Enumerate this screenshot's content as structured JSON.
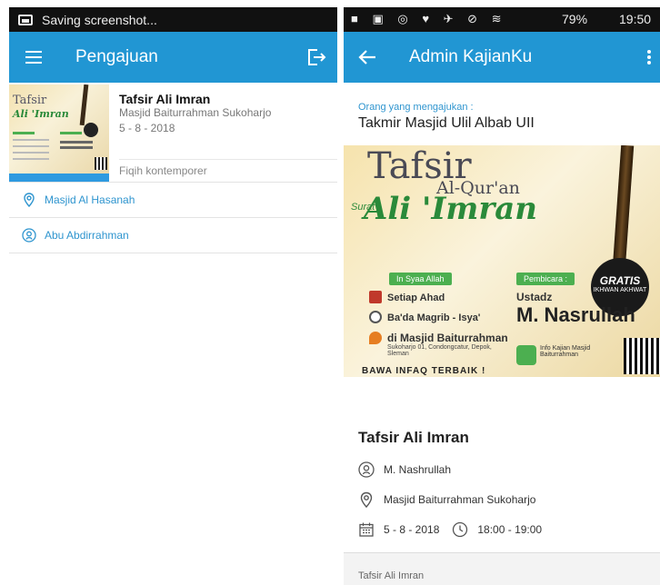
{
  "left_screen": {
    "status_bar": {
      "notification": "Saving screenshot..."
    },
    "app_bar": {
      "title": "Pengajuan"
    },
    "card": {
      "title": "Tafsir Ali Imran",
      "venue": "Masjid Baiturrahman Sukoharjo",
      "date": "5 - 8 - 2018",
      "category": "Fiqih kontemporer"
    },
    "rows": [
      {
        "icon": "location-icon",
        "label": "Masjid Al Hasanah"
      },
      {
        "icon": "speaker-icon",
        "label": "Abu Abdirrahman"
      }
    ]
  },
  "right_screen": {
    "status_bar": {
      "battery": "79%",
      "time": "19:50"
    },
    "app_bar": {
      "title": "Admin KajianKu"
    },
    "submitter_label": "Orang yang mengajukan :",
    "submitter": "Takmir Masjid Ulil Albab UII",
    "poster": {
      "title_line1": "Tafsir",
      "title_line2": "Al-Qur'an",
      "surat": "Surat",
      "surah": "Ali 'Imran",
      "badge": "GRATIS",
      "badge_sub": "IKHWAN AKHWAT",
      "pill_left": "In Syaa Allah",
      "pill_right": "Pembicara :",
      "schedule_day": "Setiap Ahad",
      "schedule_time": "Ba'da Magrib - Isya'",
      "location_name": "di Masjid Baiturrahman",
      "location_address": "Sukoharjo 01, Condongcatur, Depok, Sleman",
      "speaker_prefix": "Ustadz",
      "speaker": "M. Nasrullah",
      "info": "Info Kajian Masjid Baiturrahman",
      "footer": "BAWA INFAQ TERBAIK !"
    },
    "event": {
      "title": "Tafsir Ali Imran",
      "speaker": "M. Nashrullah",
      "venue": "Masjid Baiturrahman Sukoharjo",
      "date": "5 - 8 - 2018",
      "time": "18:00 - 19:00"
    },
    "footer": {
      "text": "Tafsir Ali Imran"
    }
  },
  "colors": {
    "primary": "#2196d3",
    "link": "#2f95cf",
    "poster_green": "#2a8a3a"
  }
}
